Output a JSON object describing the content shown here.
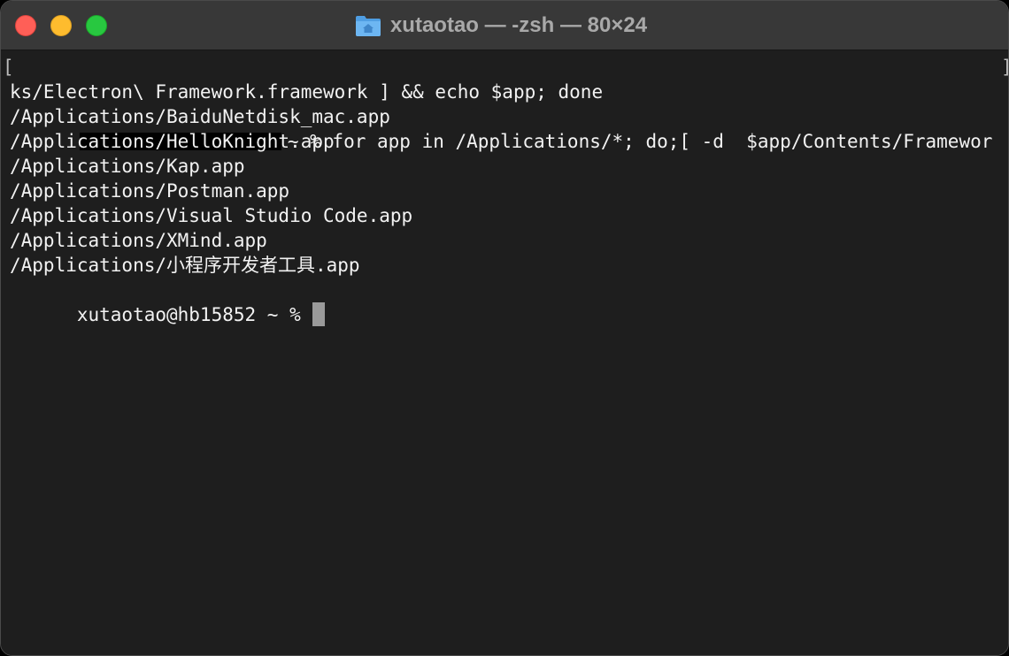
{
  "window": {
    "title": "xutaotao — -zsh — 80×24"
  },
  "terminal": {
    "command_line_1": "~ % for app in /Applications/*; do;[ -d  $app/Contents/Framewor",
    "command_line_2": "ks/Electron\\ Framework.framework ] && echo $app; done",
    "output": [
      "/Applications/BaiduNetdisk_mac.app",
      "/Applications/HelloKnight.app",
      "/Applications/Kap.app",
      "/Applications/Postman.app",
      "/Applications/Visual Studio Code.app",
      "/Applications/XMind.app",
      "/Applications/小程序开发者工具.app"
    ],
    "prompt": "xutaotao@hb15852 ~ % ",
    "wrap_left": "[",
    "wrap_right": "]"
  },
  "colors": {
    "background": "#1e1e1e",
    "titlebar": "#383838",
    "text": "#f2f2f2",
    "close": "#ff5f57",
    "minimize": "#febc2e",
    "zoom": "#28c840",
    "folder": "#5aa7e8"
  },
  "icons": {
    "title": "home-folder-icon"
  }
}
